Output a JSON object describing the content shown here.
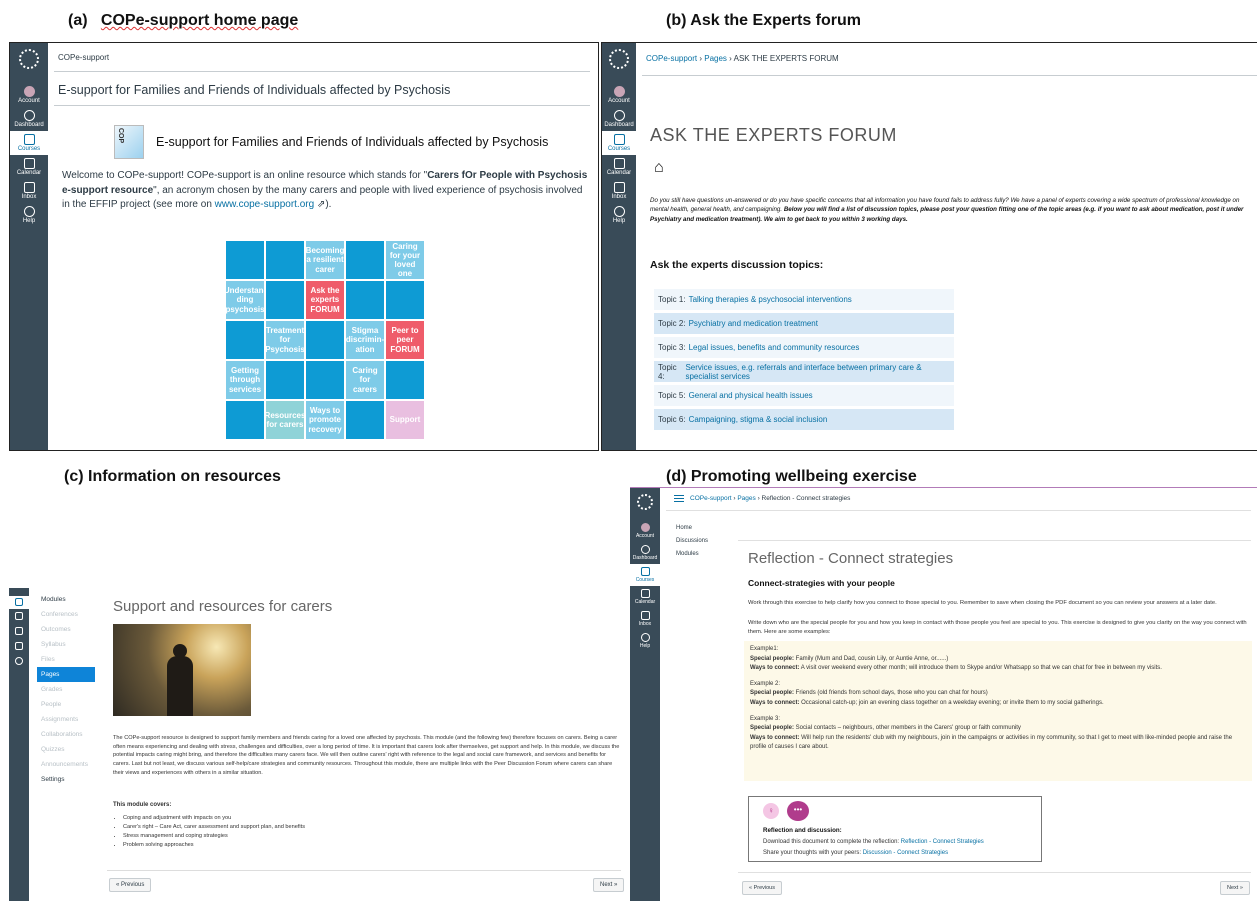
{
  "captions": {
    "a_prefix": "(a)",
    "a_title": "COPe-support home page",
    "b": "(b) Ask the Experts forum",
    "c": "(c) Information on resources",
    "d": "(d) Promoting wellbeing exercise"
  },
  "nav": {
    "account": "Account",
    "dashboard": "Dashboard",
    "courses": "Courses",
    "calendar": "Calendar",
    "inbox": "Inbox",
    "help": "Help"
  },
  "panel_a": {
    "crumb": "COPe-support",
    "page_title": "E-support for Families and Friends of Individuals affected by Psychosis",
    "logo_letters": "COP",
    "heading": "E-support for Families and Friends of Individuals affected by Psychosis",
    "intro_1": "Welcome to COPe-support! COPe-support is an online resource which stands for \"",
    "intro_bold": "Carers fOr People with Psychosis e-support resource",
    "intro_2": "\", an acronym chosen by the many carers and people with lived experience of psychosis involved in the EFFIP project (see more on ",
    "intro_link": "www.cope-support.org",
    "intro_3": " ⇗).",
    "tiles": [
      "",
      "",
      "Becoming a resilient carer",
      "",
      "Caring for your loved one",
      "Understan-ding psychosis",
      "",
      "Ask the experts FORUM",
      "",
      "",
      "",
      "Treatment for Psychosis",
      "",
      "Stigma discrimin-ation",
      "Peer to peer FORUM",
      "Getting through services",
      "",
      "",
      "Caring for carers",
      "",
      "",
      "Resources for carers",
      "Ways to promote recovery",
      "",
      "Support"
    ]
  },
  "panel_b": {
    "crumb_1": "COPe-support",
    "crumb_2": "Pages",
    "crumb_3": "ASK THE EXPERTS FORUM",
    "title": "ASK THE EXPERTS FORUM",
    "intro_plain": "Do you still have questions un-answered or do you have specific concerns that all information you have found fails to address fully? We have a panel of experts covering a wide spectrum of professional knowledge on mental health, general health, and campaigning. ",
    "intro_bold": "Below you will find a list of discussion topics, please post your question fitting one of the topic areas (e.g. if you want to ask about medication, post it under Psychiatry and medication treatment). We aim to get back to you within 3 working days.",
    "topics_heading": "Ask the experts discussion topics:",
    "topics": [
      {
        "label": "Topic 1:",
        "link": "Talking therapies & psychosocial interventions"
      },
      {
        "label": "Topic 2:",
        "link": "Psychiatry and medication treatment"
      },
      {
        "label": "Topic 3:",
        "link": "Legal issues, benefits and community resources"
      },
      {
        "label": "Topic 4:",
        "link": "Service issues, e.g. referrals and interface between primary care & specialist services"
      },
      {
        "label": "Topic 5:",
        "link": "General and physical health issues"
      },
      {
        "label": "Topic 6:",
        "link": "Campaigning, stigma & social inclusion"
      }
    ]
  },
  "panel_c": {
    "menu": [
      "Modules",
      "Conferences",
      "Outcomes",
      "Syllabus",
      "Files",
      "Pages",
      "Grades",
      "People",
      "Assignments",
      "Collaborations",
      "Quizzes",
      "Announcements",
      "Settings"
    ],
    "title": "Support and resources for carers",
    "body": "The COPe-support resource is designed to support family members and friends caring for a loved one affected by psychosis. This module (and the following few) therefore focuses on carers. Being a carer often means experiencing and dealing with stress, challenges and difficulties, over a long period of time. It is important that carers look after themselves, get support and help. In this module, we discuss the potential impacts caring might bring, and therefore the difficulties many carers face. We will then outline carers' right with reference to the legal and social care framework, and services and benefits for carers. Last but not least, we discuss various self-help/care strategies and community resources. Throughout this module, there are multiple links with the Peer Discussion Forum where carers can share their views and experiences with others in a similar situation.",
    "covers_heading": "This module covers:",
    "covers": [
      "Coping and adjustment with impacts on you",
      "Carer's right – Care Act, carer assessment and support plan, and benefits",
      "Stress management and coping strategies",
      "Problem solving approaches"
    ],
    "prev": "« Previous",
    "next": "Next »"
  },
  "panel_d": {
    "crumb_1": "COPe-support",
    "crumb_2": "Pages",
    "crumb_3": "Reflection - Connect strategies",
    "menu": [
      "Home",
      "Discussions",
      "Modules"
    ],
    "title": "Reflection - Connect strategies",
    "subtitle": "Connect-strategies with your people",
    "p1": "Work through this exercise to help clarify how you connect to those special to you. Remember to save when closing the PDF document so you can review your answers at a later date.",
    "p2": "Write down who are the special people for you and how you keep in contact with those people you feel are special to you. This exercise is designed to give you clarity on the way you connect with them. Here are some examples:",
    "examples": [
      {
        "title": "Example1:",
        "people_label": "Special people:",
        "people": " Family (Mum and Dad, cousin Lily, or Auntie Anne, or......)",
        "ways_label": "Ways to connect:",
        "ways": " A visit over weekend every other month; will introduce them to Skype and/or Whatsapp so that we can chat for free in between my visits."
      },
      {
        "title": "Example 2:",
        "people_label": "Special people:",
        "people": " Friends (old friends from school days, those who you can chat for hours)",
        "ways_label": "Ways to connect:",
        "ways": " Occasional catch-up; join an evening class together on a weekday evening; or invite them to my social gatherings."
      },
      {
        "title": "Example 3:",
        "people_label": "Special people:",
        "people": " Social contacts – neighbours, other members in the Carers' group or faith community",
        "ways_label": "Ways to connect:",
        "ways": " Will help run the residents' club with my neighbours, join in the campaigns or activities in my community, so that I get to meet with like-minded people and raise the profile of causes I care about."
      }
    ],
    "reflect_heading": "Reflection and discussion:",
    "reflect_1": "Download this document to complete the reflection: ",
    "reflect_1_link": "Reflection - Connect Strategies",
    "reflect_2": "Share your thoughts with your peers: ",
    "reflect_2_link": "Discussion - Connect Strategies",
    "prev": "« Previous",
    "next": "Next »"
  },
  "colors": {
    "nav": "#394b58",
    "tile_blue": "#0e9bd4",
    "tile_red": "#ef5c6a",
    "link": "#0770a3"
  }
}
